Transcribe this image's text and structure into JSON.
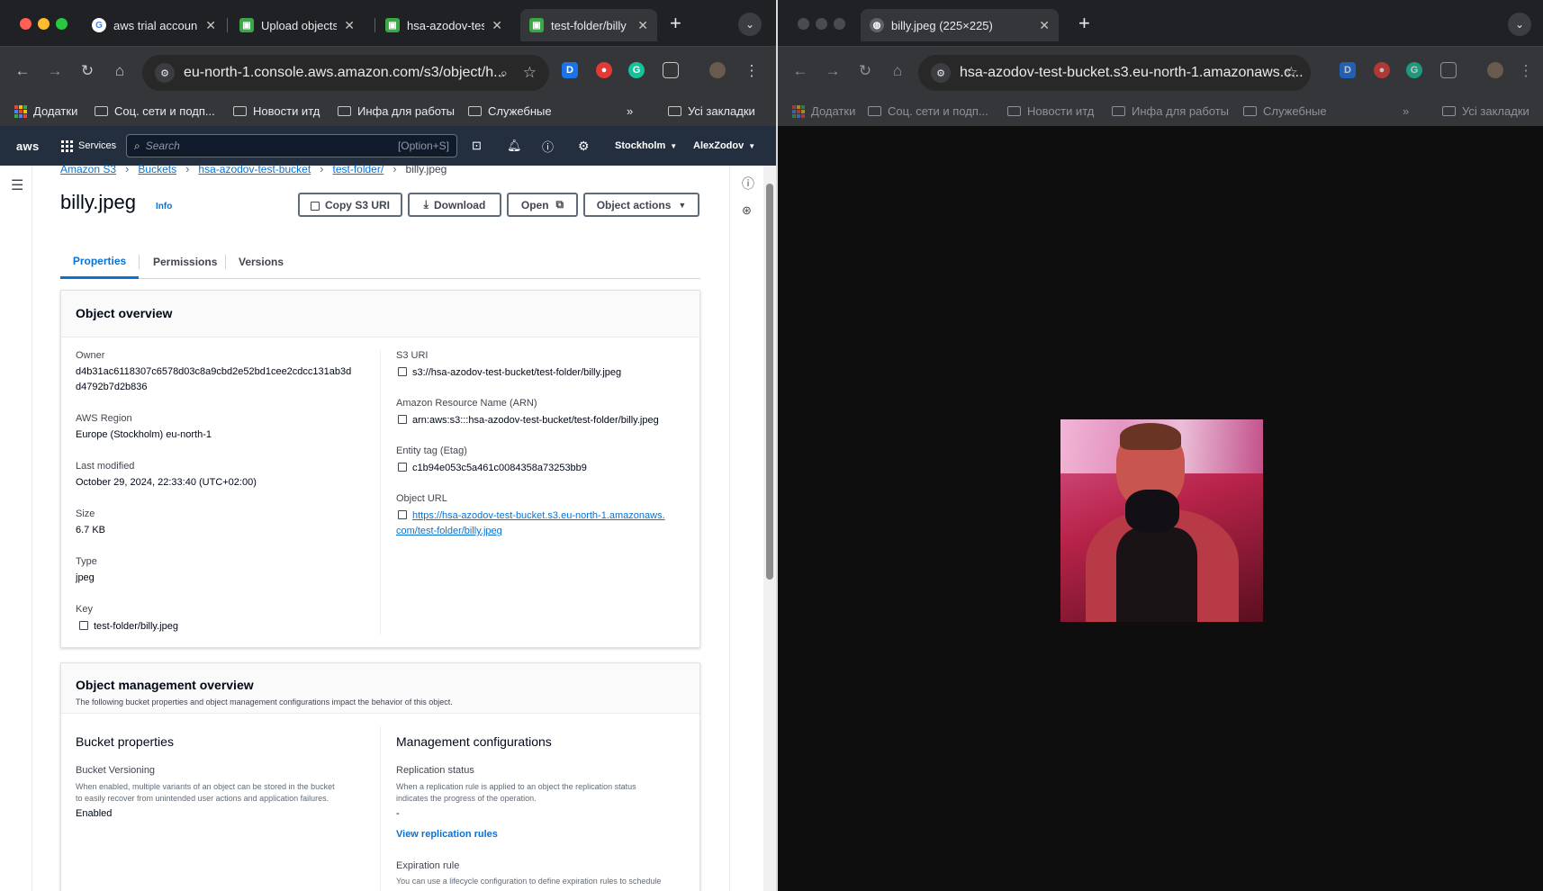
{
  "left": {
    "tabs": [
      {
        "label": "aws trial accoun",
        "icon": "google-icon"
      },
      {
        "label": "Upload objects",
        "icon": "aws-s3-favicon"
      },
      {
        "label": "hsa-azodov-tes",
        "icon": "aws-s3-favicon"
      },
      {
        "label": "test-folder/billy",
        "icon": "aws-s3-favicon"
      }
    ],
    "url": "eu-north-1.console.aws.amazon.com/s3/object/h...",
    "bookmarks": [
      "Додатки",
      "Соц. сети и подп...",
      "Новости итд",
      "Инфа для работы",
      "Служебные",
      "Усі закладки"
    ],
    "aws": {
      "services": "Services",
      "search_placeholder": "Search",
      "shortcut": "[Option+S]",
      "region": "Stockholm",
      "user": "AlexZodov"
    },
    "breadcrumb": [
      "Amazon S3",
      "Buckets",
      "hsa-azodov-test-bucket",
      "test-folder/",
      "billy.jpeg"
    ],
    "title": "billy.jpeg",
    "info": "Info",
    "buttons": {
      "copy": "Copy S3 URI",
      "download": "Download",
      "open": "Open",
      "actions": "Object actions"
    },
    "page_tabs": [
      "Properties",
      "Permissions",
      "Versions"
    ],
    "overview": {
      "heading": "Object overview",
      "owner_label": "Owner",
      "owner_line1": "d4b31ac6118307c6578d03c8a9cbd2e52bd1cee2cdcc131ab3d",
      "owner_line2": "d4792b7d2b836",
      "region_label": "AWS Region",
      "region": "Europe (Stockholm) eu-north-1",
      "modified_label": "Last modified",
      "modified": "October 29, 2024, 22:33:40 (UTC+02:00)",
      "size_label": "Size",
      "size": "6.7 KB",
      "type_label": "Type",
      "type": "jpeg",
      "key_label": "Key",
      "key": "test-folder/billy.jpeg",
      "s3uri_label": "S3 URI",
      "s3uri": "s3://hsa-azodov-test-bucket/test-folder/billy.jpeg",
      "arn_label": "Amazon Resource Name (ARN)",
      "arn": "arn:aws:s3:::hsa-azodov-test-bucket/test-folder/billy.jpeg",
      "etag_label": "Entity tag (Etag)",
      "etag": "c1b94e053c5a461c0084358a73253bb9",
      "url_label": "Object URL",
      "url_line1": "https://hsa-azodov-test-bucket.s3.eu-north-1.amazonaws.",
      "url_line2": "com/test-folder/billy.jpeg"
    },
    "management": {
      "heading": "Object management overview",
      "subtitle": "The following bucket properties and object management configurations impact the behavior of this object.",
      "bucket_props": "Bucket properties",
      "versioning_label": "Bucket Versioning",
      "versioning_desc1": "When enabled, multiple variants of an object can be stored in the bucket",
      "versioning_desc2": "to easily recover from unintended user actions and application failures.",
      "versioning_value": "Enabled",
      "mgmt_configs": "Management configurations",
      "replication_label": "Replication status",
      "replication_desc1": "When a replication rule is applied to an object the replication status",
      "replication_desc2": "indicates the progress of the operation.",
      "replication_value": "-",
      "replication_link": "View replication rules",
      "expiration_label": "Expiration rule",
      "expiration_desc": "You can use a lifecycle configuration to define expiration rules to schedule"
    }
  },
  "right": {
    "tab": "billy.jpeg (225×225)",
    "url": "hsa-azodov-test-bucket.s3.eu-north-1.amazonaws.c...",
    "bookmarks": [
      "Додатки",
      "Соц. сети и подп...",
      "Новости итд",
      "Инфа для работы",
      "Служебные",
      "Усі закладки"
    ]
  },
  "colors": {
    "aws_nav": "#232f3e",
    "link": "#0972d3",
    "tab_active": "#0972d3",
    "chrome_dark": "#202124"
  }
}
